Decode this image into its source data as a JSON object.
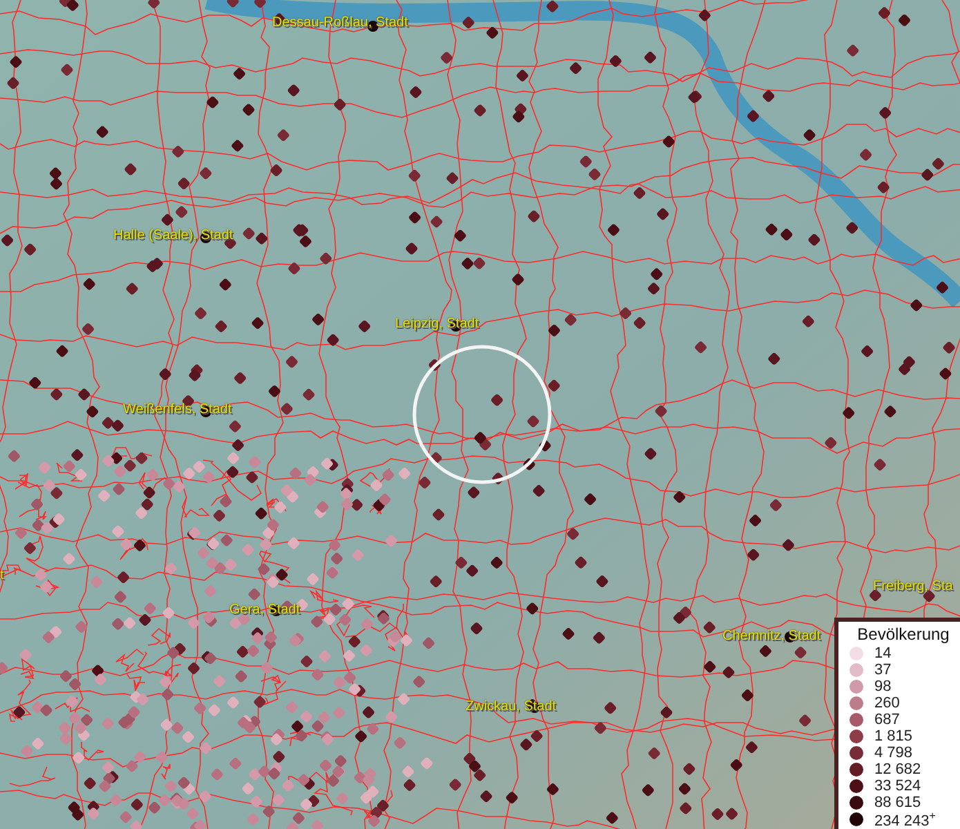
{
  "map": {
    "city_labels": [
      {
        "text": "Dessau-Roßlau, Stadt"
      },
      {
        "text": "Halle (Saale), Stadt"
      },
      {
        "text": "Leipzig, Stadt"
      },
      {
        "text": "Weißenfels, Stadt"
      },
      {
        "text": "t"
      },
      {
        "text": "Freiberg, Sta"
      },
      {
        "text": "Gera, Stadt"
      },
      {
        "text": "Chemnitz, Stadt"
      },
      {
        "text": "Zwickau, Stadt"
      }
    ]
  },
  "legend": {
    "title": "Bevölkerung",
    "items": [
      {
        "label": "14",
        "color": "#f5dde8"
      },
      {
        "label": "37",
        "color": "#e2bcc8"
      },
      {
        "label": "98",
        "color": "#d09aa8"
      },
      {
        "label": "260",
        "color": "#bd7c8a"
      },
      {
        "label": "687",
        "color": "#a85a68"
      },
      {
        "label": "1 815",
        "color": "#8e3c48"
      },
      {
        "label": "4 798",
        "color": "#782c36"
      },
      {
        "label": "12 682",
        "color": "#641c24"
      },
      {
        "label": "33 524",
        "color": "#4e1016"
      },
      {
        "label": "88 615",
        "color": "#380a0e"
      },
      {
        "label": "234 243$^{+}$",
        "color": "#200406"
      }
    ]
  }
}
